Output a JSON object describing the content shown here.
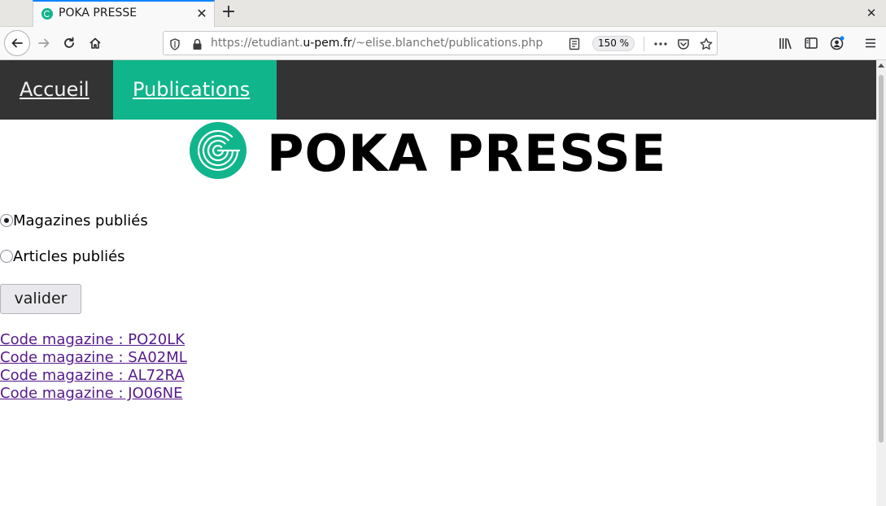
{
  "browser": {
    "tab_title": "POKA PRESSE",
    "url_prefix": "https://etudiant.",
    "url_domain": "u-pem.fr",
    "url_path": "/~elise.blanchet/publications.php",
    "zoom": "150 %",
    "icons": [
      "back-arrow-icon",
      "forward-arrow-icon",
      "reload-icon",
      "home-icon",
      "shield-icon",
      "lock-icon",
      "reader-view-icon",
      "more-icon",
      "pocket-icon",
      "star-icon",
      "library-icon",
      "sidebar-icon",
      "account-icon",
      "menu-icon"
    ]
  },
  "site_nav": {
    "items": [
      {
        "label": "Accueil"
      },
      {
        "label": "Publications",
        "active": true
      }
    ]
  },
  "brand": {
    "title": "POKA PRESSE",
    "accent_color": "#10b58b"
  },
  "form": {
    "options": [
      {
        "label": "Magazines publiés",
        "checked": true
      },
      {
        "label": "Articles publiés",
        "checked": false
      }
    ],
    "submit_label": "valider"
  },
  "magazines": [
    "Code magazine : PO20LK",
    "Code magazine : SA02ML",
    "Code magazine : AL72RA",
    "Code magazine : JO06NE"
  ],
  "colors": {
    "nav_bg": "#333333",
    "nav_active": "#10b58b",
    "link_visited": "#551a8b"
  }
}
